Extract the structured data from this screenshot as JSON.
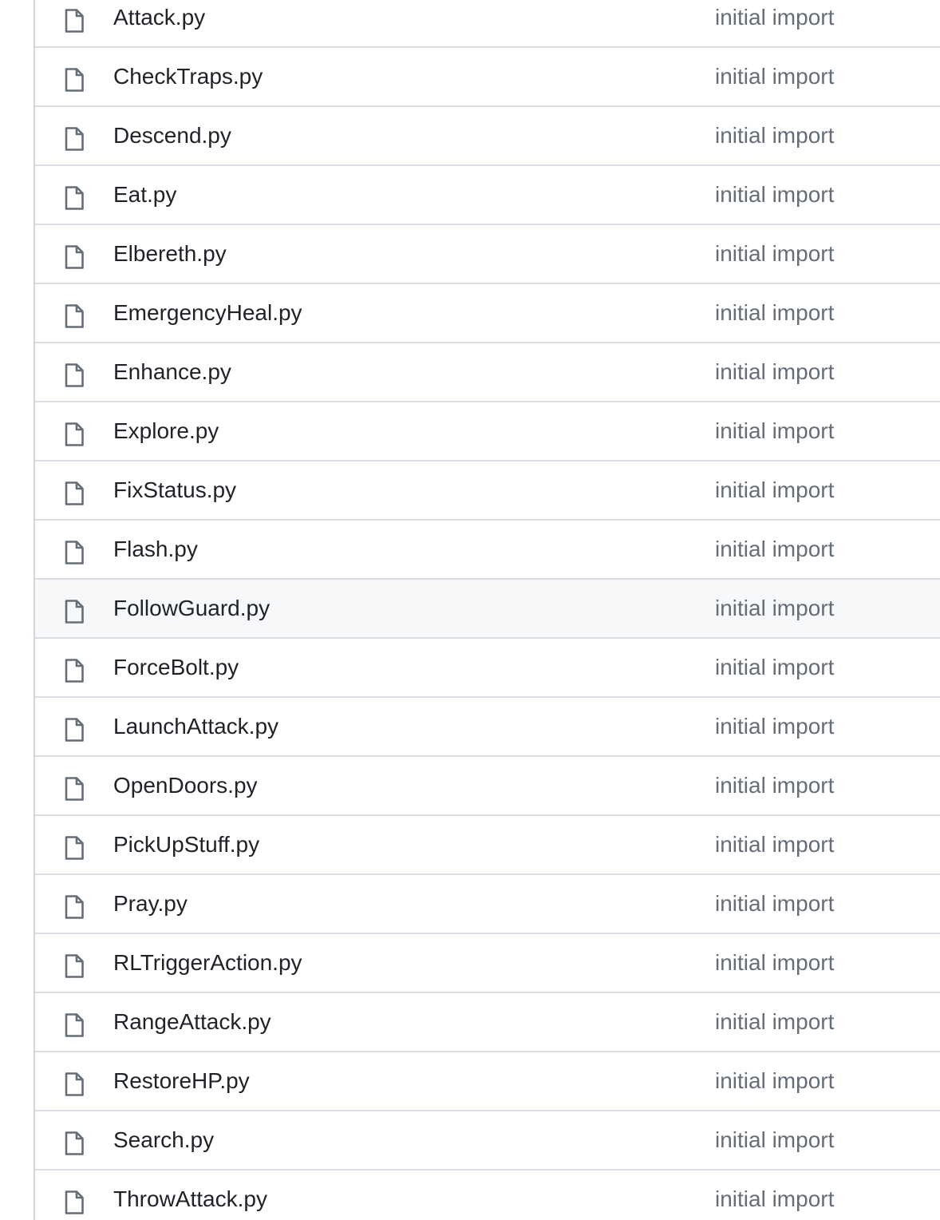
{
  "files": [
    {
      "name": "Attack.py",
      "commit": "initial import",
      "icon": "file-icon"
    },
    {
      "name": "CheckTraps.py",
      "commit": "initial import",
      "icon": "file-icon"
    },
    {
      "name": "Descend.py",
      "commit": "initial import",
      "icon": "file-icon"
    },
    {
      "name": "Eat.py",
      "commit": "initial import",
      "icon": "file-icon"
    },
    {
      "name": "Elbereth.py",
      "commit": "initial import",
      "icon": "file-icon"
    },
    {
      "name": "EmergencyHeal.py",
      "commit": "initial import",
      "icon": "file-icon"
    },
    {
      "name": "Enhance.py",
      "commit": "initial import",
      "icon": "file-icon"
    },
    {
      "name": "Explore.py",
      "commit": "initial import",
      "icon": "file-icon"
    },
    {
      "name": "FixStatus.py",
      "commit": "initial import",
      "icon": "file-icon"
    },
    {
      "name": "Flash.py",
      "commit": "initial import",
      "icon": "file-icon"
    },
    {
      "name": "FollowGuard.py",
      "commit": "initial import",
      "icon": "file-icon",
      "hovered": true
    },
    {
      "name": "ForceBolt.py",
      "commit": "initial import",
      "icon": "file-icon"
    },
    {
      "name": "LaunchAttack.py",
      "commit": "initial import",
      "icon": "file-icon"
    },
    {
      "name": "OpenDoors.py",
      "commit": "initial import",
      "icon": "file-icon"
    },
    {
      "name": "PickUpStuff.py",
      "commit": "initial import",
      "icon": "file-icon"
    },
    {
      "name": "Pray.py",
      "commit": "initial import",
      "icon": "file-icon"
    },
    {
      "name": "RLTriggerAction.py",
      "commit": "initial import",
      "icon": "file-icon"
    },
    {
      "name": "RangeAttack.py",
      "commit": "initial import",
      "icon": "file-icon"
    },
    {
      "name": "RestoreHP.py",
      "commit": "initial import",
      "icon": "file-icon"
    },
    {
      "name": "Search.py",
      "commit": "initial import",
      "icon": "file-icon"
    },
    {
      "name": "ThrowAttack.py",
      "commit": "initial import",
      "icon": "file-icon"
    }
  ],
  "colors": {
    "file_name": "#1f2328",
    "commit_message": "#656d76",
    "row_border": "#d8dee4",
    "hover_background": "#f6f8fa"
  }
}
